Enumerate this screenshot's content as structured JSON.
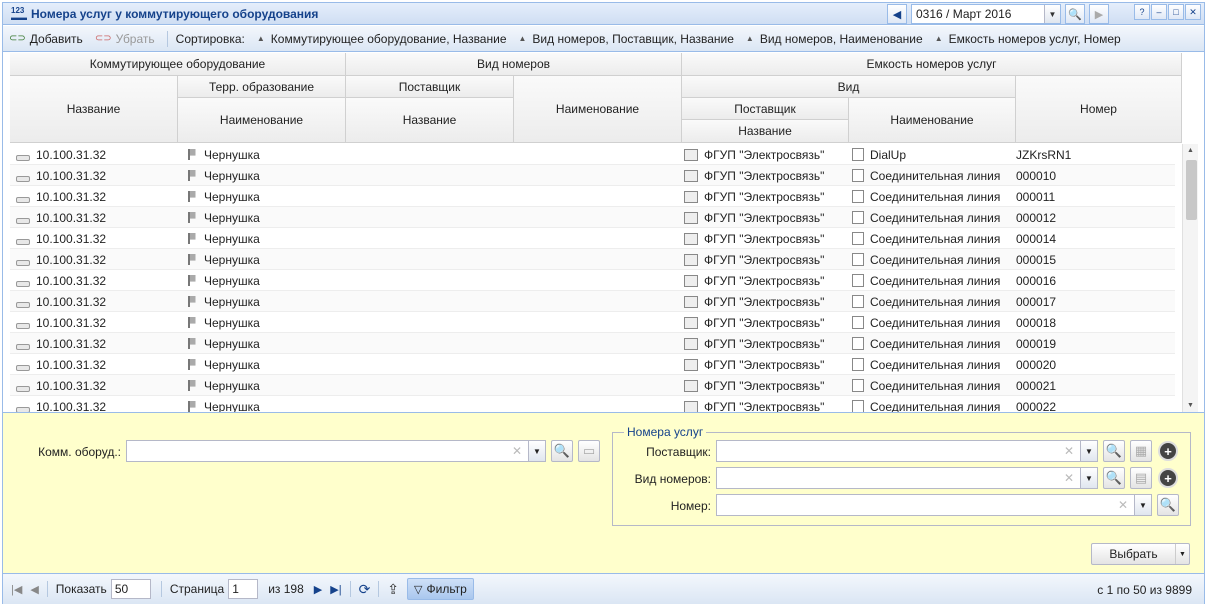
{
  "window": {
    "title": "Номера услуг у коммутирующего оборудования",
    "period": "0316 / Март 2016"
  },
  "toolbar": {
    "add": "Добавить",
    "remove": "Убрать",
    "sort_label": "Сортировка:",
    "sorts": [
      "Коммутирующее оборудование, Название",
      "Вид номеров, Поставщик, Название",
      "Вид номеров, Наименование",
      "Емкость номеров услуг, Номер"
    ]
  },
  "header": {
    "g1": "Коммутирующее оборудование",
    "g2": "Вид номеров",
    "g3": "Емкость номеров услуг",
    "name": "Название",
    "terr": "Терр. образование",
    "terr_name": "Наименование",
    "supplier": "Поставщик",
    "supplier_name": "Название",
    "vn_name": "Наименование",
    "vid": "Вид",
    "vid_supplier": "Поставщик",
    "vid_supplier_name": "Название",
    "vid_name": "Наименование",
    "number": "Номер"
  },
  "rows": [
    {
      "eq": "10.100.31.32",
      "terr": "Чернушка",
      "sup": "ФГУП \"Электросвязь\"",
      "kind": "DialUp",
      "num": "JZKrsRN1"
    },
    {
      "eq": "10.100.31.32",
      "terr": "Чернушка",
      "sup": "ФГУП \"Электросвязь\"",
      "kind": "Соединительная линия",
      "num": "000010"
    },
    {
      "eq": "10.100.31.32",
      "terr": "Чернушка",
      "sup": "ФГУП \"Электросвязь\"",
      "kind": "Соединительная линия",
      "num": "000011"
    },
    {
      "eq": "10.100.31.32",
      "terr": "Чернушка",
      "sup": "ФГУП \"Электросвязь\"",
      "kind": "Соединительная линия",
      "num": "000012"
    },
    {
      "eq": "10.100.31.32",
      "terr": "Чернушка",
      "sup": "ФГУП \"Электросвязь\"",
      "kind": "Соединительная линия",
      "num": "000014"
    },
    {
      "eq": "10.100.31.32",
      "terr": "Чернушка",
      "sup": "ФГУП \"Электросвязь\"",
      "kind": "Соединительная линия",
      "num": "000015"
    },
    {
      "eq": "10.100.31.32",
      "terr": "Чернушка",
      "sup": "ФГУП \"Электросвязь\"",
      "kind": "Соединительная линия",
      "num": "000016"
    },
    {
      "eq": "10.100.31.32",
      "terr": "Чернушка",
      "sup": "ФГУП \"Электросвязь\"",
      "kind": "Соединительная линия",
      "num": "000017"
    },
    {
      "eq": "10.100.31.32",
      "terr": "Чернушка",
      "sup": "ФГУП \"Электросвязь\"",
      "kind": "Соединительная линия",
      "num": "000018"
    },
    {
      "eq": "10.100.31.32",
      "terr": "Чернушка",
      "sup": "ФГУП \"Электросвязь\"",
      "kind": "Соединительная линия",
      "num": "000019"
    },
    {
      "eq": "10.100.31.32",
      "terr": "Чернушка",
      "sup": "ФГУП \"Электросвязь\"",
      "kind": "Соединительная линия",
      "num": "000020"
    },
    {
      "eq": "10.100.31.32",
      "terr": "Чернушка",
      "sup": "ФГУП \"Электросвязь\"",
      "kind": "Соединительная линия",
      "num": "000021"
    },
    {
      "eq": "10.100.31.32",
      "terr": "Чернушка",
      "sup": "ФГУП \"Электросвязь\"",
      "kind": "Соединительная линия",
      "num": "000022"
    }
  ],
  "filter": {
    "equip_label": "Комм. оборуд.:",
    "group": "Номера услуг",
    "supplier_label": "Поставщик:",
    "kind_label": "Вид номеров:",
    "number_label": "Номер:",
    "choose": "Выбрать"
  },
  "pager": {
    "show_label": "Показать",
    "page_size": "50",
    "page_label": "Страница",
    "page": "1",
    "of": "из 198",
    "filter": "Фильтр",
    "status": "с 1 по 50 из 9899"
  }
}
